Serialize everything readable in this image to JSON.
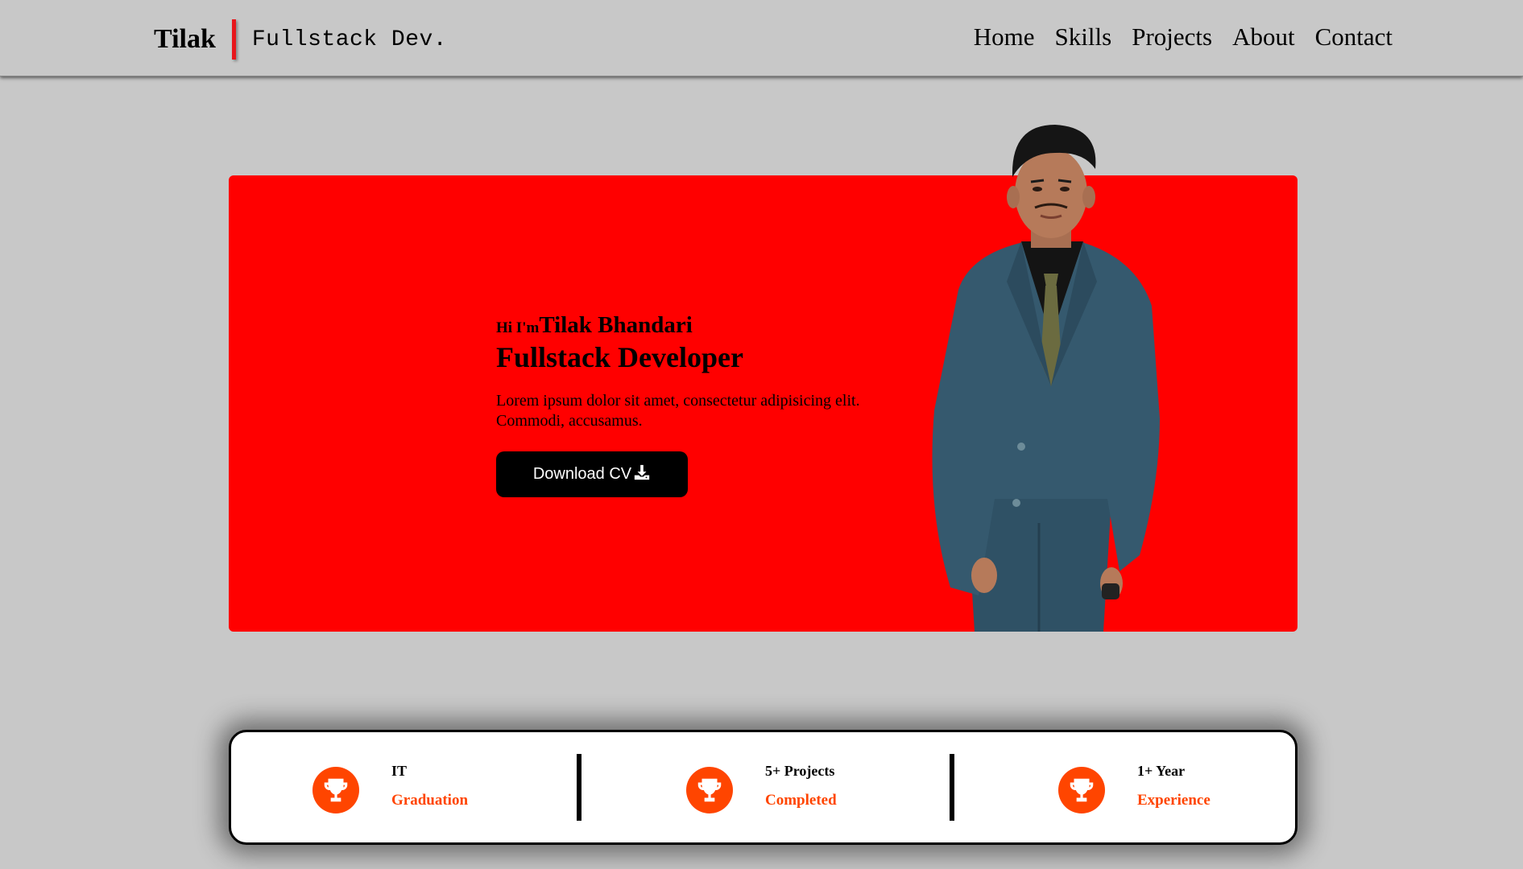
{
  "header": {
    "brand_name": "Tilak",
    "brand_tagline": "Fullstack Dev.",
    "nav": [
      "Home",
      "Skills",
      "Projects",
      "About",
      "Contact"
    ]
  },
  "hero": {
    "greeting": "Hi I'm",
    "name": "Tilak Bhandari",
    "role": "Fullstack Developer",
    "description": "Lorem ipsum dolor sit amet, consectetur adipisicing elit. Commodi, accusamus.",
    "cta_label": "Download CV"
  },
  "stats": [
    {
      "title": "IT",
      "subtitle": "Graduation"
    },
    {
      "title": "5+ Projects",
      "subtitle": "Completed"
    },
    {
      "title": "1+ Year",
      "subtitle": "Experience"
    }
  ],
  "icons": {
    "download": "download-icon",
    "trophy": "trophy-icon"
  },
  "colors": {
    "page_bg": "#c8c8c8",
    "hero_bg": "#ff0000",
    "accent": "#ff4500",
    "brand_bar": "#e8161b",
    "button_bg": "#000000"
  }
}
